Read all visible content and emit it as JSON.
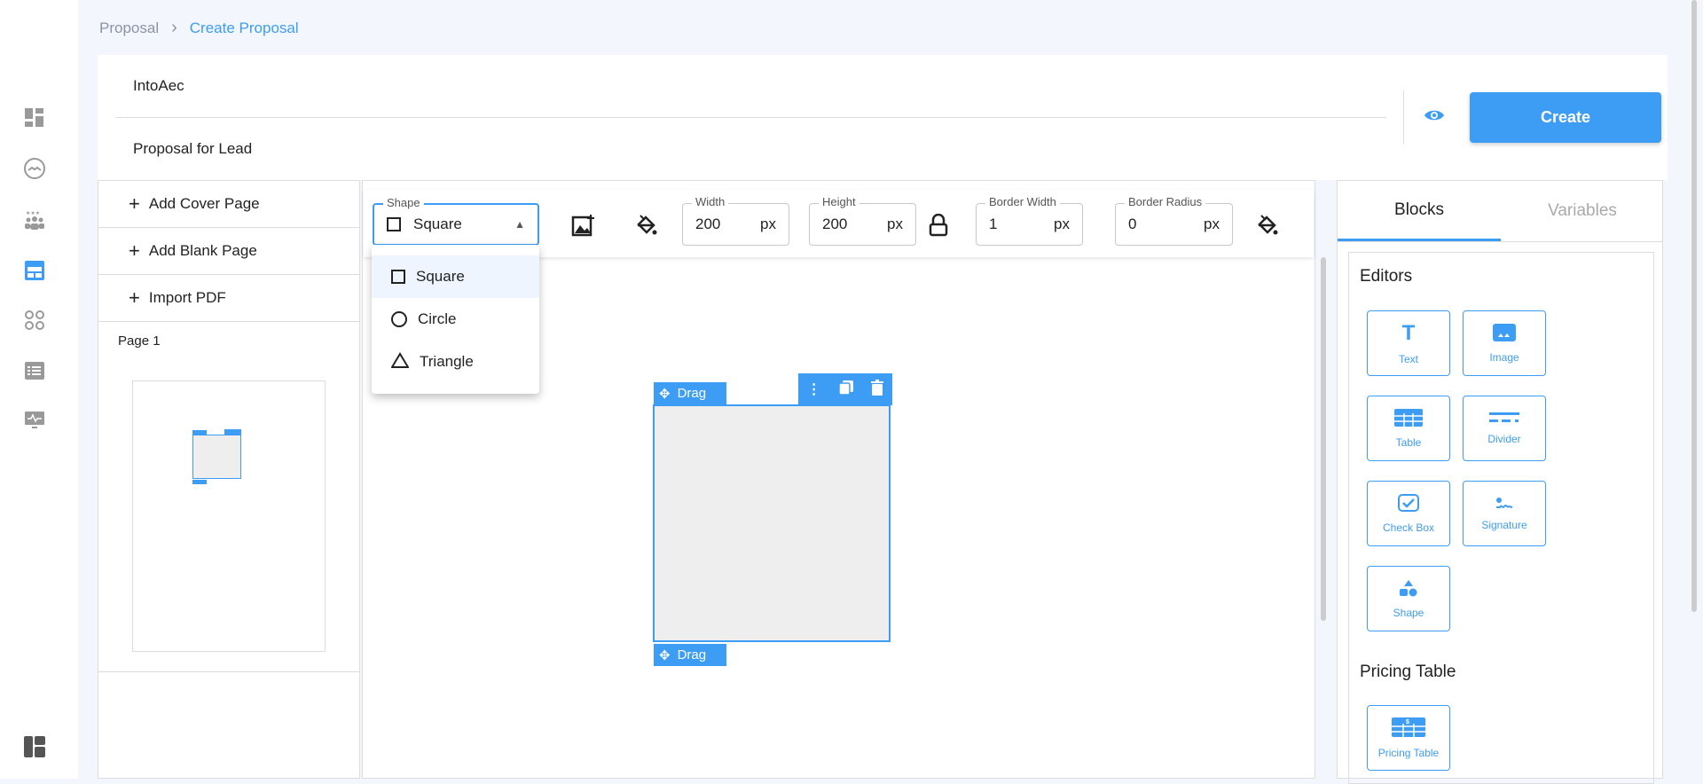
{
  "breadcrumb": {
    "parent": "Proposal",
    "current": "Create Proposal"
  },
  "header": {
    "company": "IntoAec",
    "title": "Proposal for Lead",
    "create_label": "Create"
  },
  "left_panel": {
    "actions": [
      "Add Cover Page",
      "Add Blank Page",
      "Import PDF"
    ],
    "page_label": "Page 1"
  },
  "toolbar": {
    "shape_label": "Shape",
    "shape_value": "Square",
    "width_label": "Width",
    "width_value": "200",
    "height_label": "Height",
    "height_value": "200",
    "border_width_label": "Border Width",
    "border_width_value": "1",
    "border_radius_label": "Border Radius",
    "border_radius_value": "0",
    "unit": "px"
  },
  "shape_menu": [
    "Square",
    "Circle",
    "Triangle"
  ],
  "canvas": {
    "drag_label": "Drag"
  },
  "right_panel": {
    "tabs": [
      "Blocks",
      "Variables"
    ],
    "editors_heading": "Editors",
    "blocks": [
      "Text",
      "Image",
      "Table",
      "Divider",
      "Check Box",
      "Signature",
      "Shape"
    ],
    "pricing_heading": "Pricing Table",
    "pricing_block": "Pricing Table"
  },
  "colors": {
    "accent": "#3d9df5",
    "background": "#f3f7fd"
  }
}
